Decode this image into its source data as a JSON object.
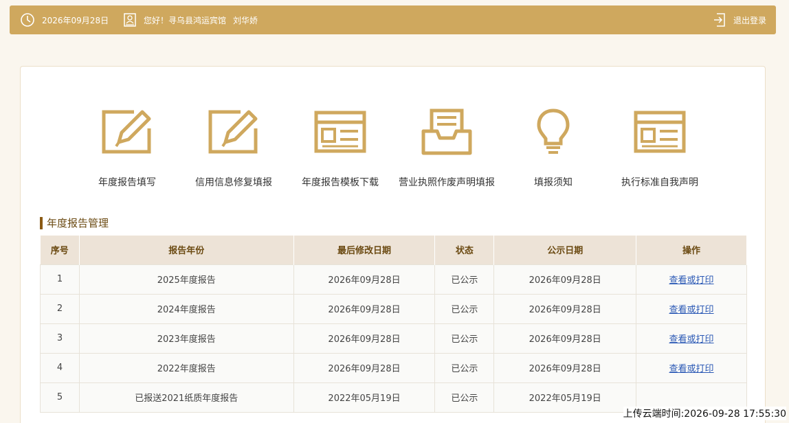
{
  "topbar": {
    "date": "2026年09月28日",
    "greeting": "您好！寻乌县鸿运宾馆",
    "username": "刘华娇",
    "logout_label": "退出登录"
  },
  "tiles": [
    {
      "label": "年度报告填写",
      "icon": "edit-icon"
    },
    {
      "label": "信用信息修复填报",
      "icon": "edit-icon"
    },
    {
      "label": "年度报告模板下载",
      "icon": "template-icon"
    },
    {
      "label": "营业执照作废声明填报",
      "icon": "inbox-icon"
    },
    {
      "label": "填报须知",
      "icon": "lightbulb-icon"
    },
    {
      "label": "执行标准自我声明",
      "icon": "template-icon"
    }
  ],
  "section_title": "年度报告管理",
  "table": {
    "headers": [
      "序号",
      "报告年份",
      "最后修改日期",
      "状态",
      "公示日期",
      "操作"
    ],
    "rows": [
      [
        "1",
        "2025年度报告",
        "2026年09月28日",
        "已公示",
        "2026年09月28日",
        "查看或打印"
      ],
      [
        "2",
        "2024年度报告",
        "2026年09月28日",
        "已公示",
        "2026年09月28日",
        "查看或打印"
      ],
      [
        "3",
        "2023年度报告",
        "2026年09月28日",
        "已公示",
        "2026年09月28日",
        "查看或打印"
      ],
      [
        "4",
        "2022年度报告",
        "2026年09月28日",
        "已公示",
        "2026年09月28日",
        "查看或打印"
      ],
      [
        "5",
        "已报送2021纸质年度报告",
        "2022年05月19日",
        "已公示",
        "2022年05月19日",
        ""
      ]
    ]
  },
  "upload_stamp": "上传云端时间:2026-09-28 17:55:30",
  "colors": {
    "accent": "#cfa85e",
    "link": "#2a58b5",
    "title_bar": "#8a5a14"
  }
}
